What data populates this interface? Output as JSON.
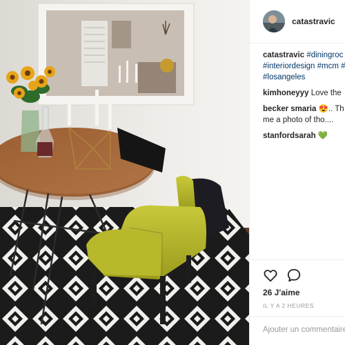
{
  "post": {
    "username": "catastravic",
    "caption_user": "catastravic",
    "caption_lines": [
      "#diningroc",
      "#interiordesign #mcm #",
      "#losangeles"
    ],
    "comments": [
      {
        "user": "kimhoneyyy",
        "text": "Love the",
        "cont": ""
      },
      {
        "user": "becker smaria",
        "text": "😍.. Th",
        "cont": "me a photo of tho...."
      },
      {
        "user": "stanfordsarah",
        "text": "💚",
        "cont": ""
      }
    ],
    "likes": "26 J'aime",
    "timestamp": "IL Y A 2 HEURES",
    "add_comment_placeholder": "Ajouter un commentaire"
  },
  "icons": {
    "like": "heart-outline-icon",
    "comment": "speech-bubble-icon"
  },
  "colors": {
    "link": "#003569",
    "text": "#262626",
    "muted": "#999999",
    "border": "#efefef"
  }
}
